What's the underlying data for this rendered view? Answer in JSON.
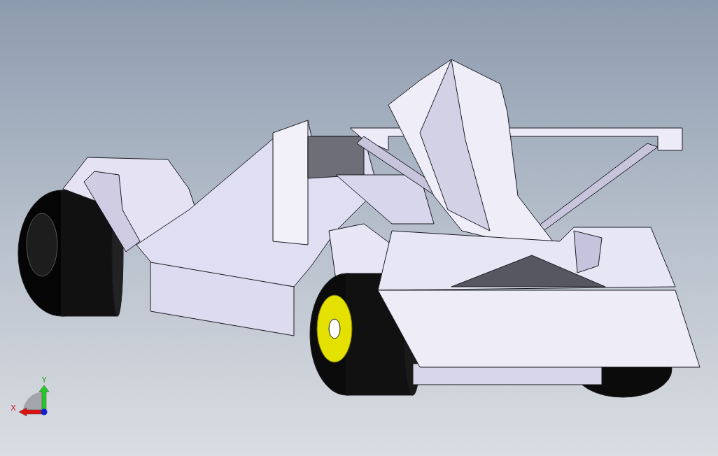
{
  "triad": {
    "axes": [
      {
        "kind": "y",
        "label": "Y"
      },
      {
        "kind": "x",
        "label": "X"
      }
    ]
  }
}
